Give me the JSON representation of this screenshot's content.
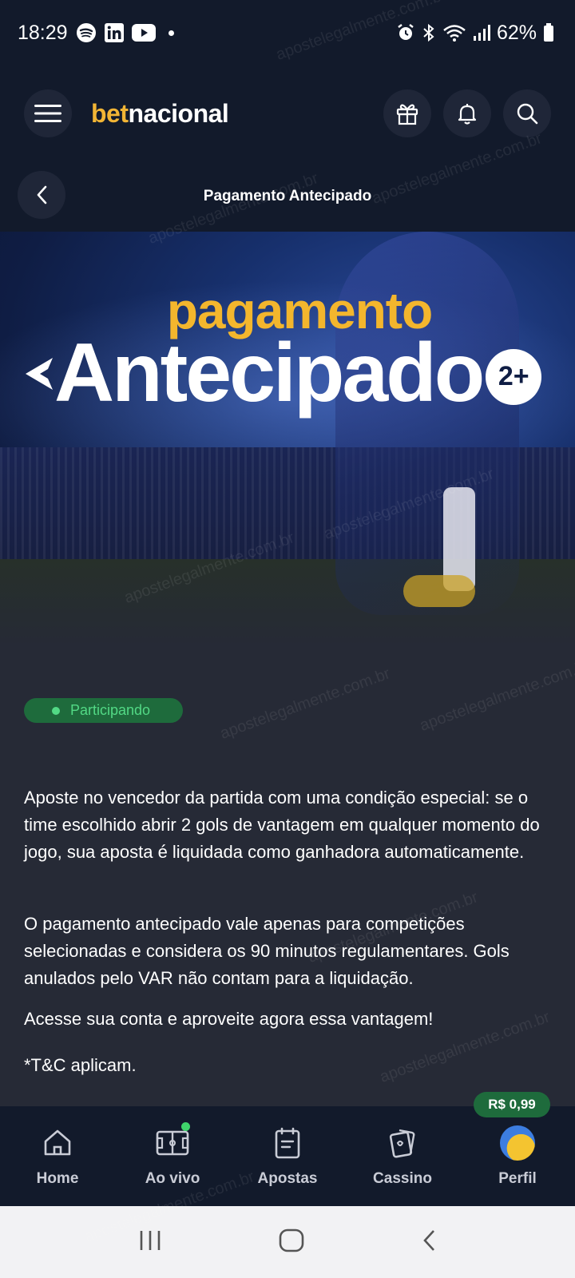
{
  "status_bar": {
    "time": "18:29",
    "battery": "62%",
    "icons": [
      "spotify-icon",
      "linkedin-icon",
      "youtube-icon",
      "alarm-icon",
      "bluetooth-icon",
      "wifi-icon",
      "signal-icon",
      "battery-icon"
    ]
  },
  "header": {
    "logo_bet": "bet",
    "logo_nacional": "nacional",
    "icons": [
      "menu-icon",
      "gift-icon",
      "bell-icon",
      "search-icon"
    ]
  },
  "titlebar": {
    "title": "Pagamento Antecipado"
  },
  "banner": {
    "line1": "pagamento",
    "line2": "Antecipado",
    "badge": "2+"
  },
  "status_chip": {
    "label": "Participando",
    "color": "#52d985"
  },
  "content": {
    "paragraph1": "Aposte no vencedor da partida com uma condição especial: se o time escolhido abrir 2 gols de vantagem em qualquer momento do jogo, sua aposta é liquidada como ganhadora automaticamente.",
    "paragraph2": "O pagamento antecipado vale apenas para competições selecionadas e considera os 90 minutos regulamentares. Gols anulados pelo VAR não contam para a liquidação.",
    "paragraph3": "Acesse sua conta e aproveite agora essa vantagem!",
    "paragraph4": "*T&C aplicam."
  },
  "bottom_nav": {
    "balance": "R$ 0,99",
    "items": [
      {
        "label": "Home",
        "icon": "home-icon"
      },
      {
        "label": "Ao vivo",
        "icon": "live-field-icon"
      },
      {
        "label": "Apostas",
        "icon": "bets-icon"
      },
      {
        "label": "Cassino",
        "icon": "cards-icon"
      },
      {
        "label": "Perfil",
        "icon": "avatar-icon"
      }
    ]
  },
  "watermark": "apostelegalmente.com.br",
  "colors": {
    "brand_yellow": "#f2b535",
    "header_bg": "#121a2b",
    "content_bg": "#262a36",
    "chip_bg": "#1e6b3c"
  }
}
